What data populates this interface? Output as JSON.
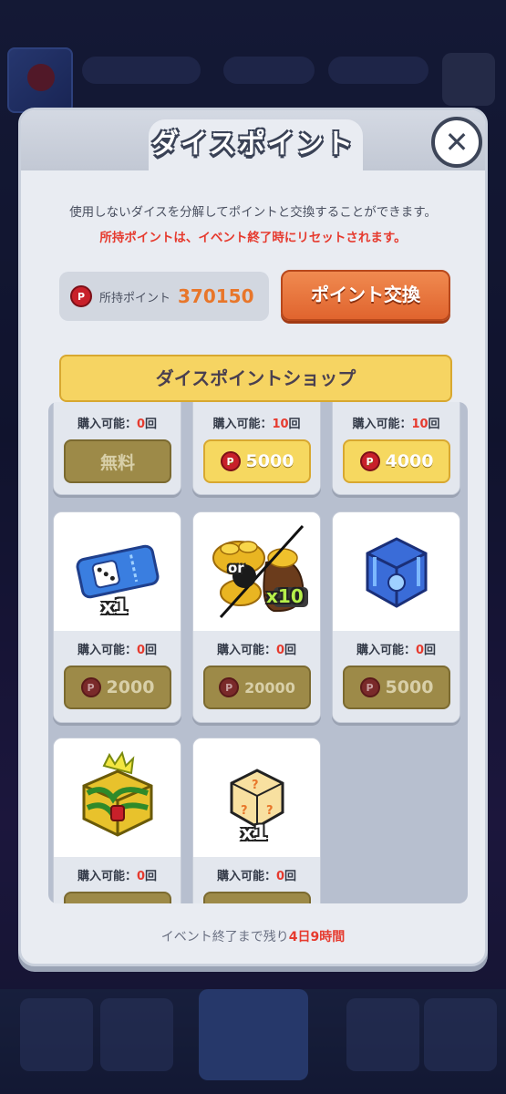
{
  "modal": {
    "title": "ダイスポイント",
    "close_glyph": "✕",
    "description": "使用しないダイスを分解してポイントと交換することができます。",
    "warning": "所持ポイントは、イベント終了時にリセットされます。"
  },
  "points": {
    "coin_letter": "P",
    "label": "所持ポイント",
    "value": "370150",
    "exchange_label": "ポイント交換"
  },
  "shop": {
    "title": "ダイスポイントショップ",
    "avail_prefix": "購入可能：",
    "avail_suffix": "回",
    "items": [
      {
        "name": "top-left",
        "count": "0",
        "price": "無料",
        "state": "disabled"
      },
      {
        "name": "top-middle",
        "count": "10",
        "price": "5000",
        "state": "enabled"
      },
      {
        "name": "top-right",
        "count": "10",
        "price": "4000",
        "state": "enabled"
      },
      {
        "name": "dice-ticket",
        "count": "0",
        "price": "2000",
        "state": "disabled",
        "qty": "x1",
        "icon": "ticket-icon"
      },
      {
        "name": "gold-pile",
        "count": "0",
        "price": "20000",
        "state": "disabled",
        "qty": "x10",
        "badge": "or",
        "icon": "gold-icon"
      },
      {
        "name": "blue-chest",
        "count": "0",
        "price": "5000",
        "state": "disabled",
        "icon": "chest-icon"
      },
      {
        "name": "gold-chest",
        "count": "0",
        "state": "disabled",
        "icon": "legend-chest-icon"
      },
      {
        "name": "mystery-dice",
        "count": "0",
        "state": "disabled",
        "qty": "x1",
        "icon": "mystery-dice-icon"
      }
    ]
  },
  "footer": {
    "prefix": "イベント終了まで残り",
    "remaining": "4日9時間"
  },
  "colors": {
    "accent_red": "#e63a2e",
    "points_orange": "#e8762a",
    "exchange_button": "#e0642e",
    "shop_yellow": "#f6d462"
  }
}
